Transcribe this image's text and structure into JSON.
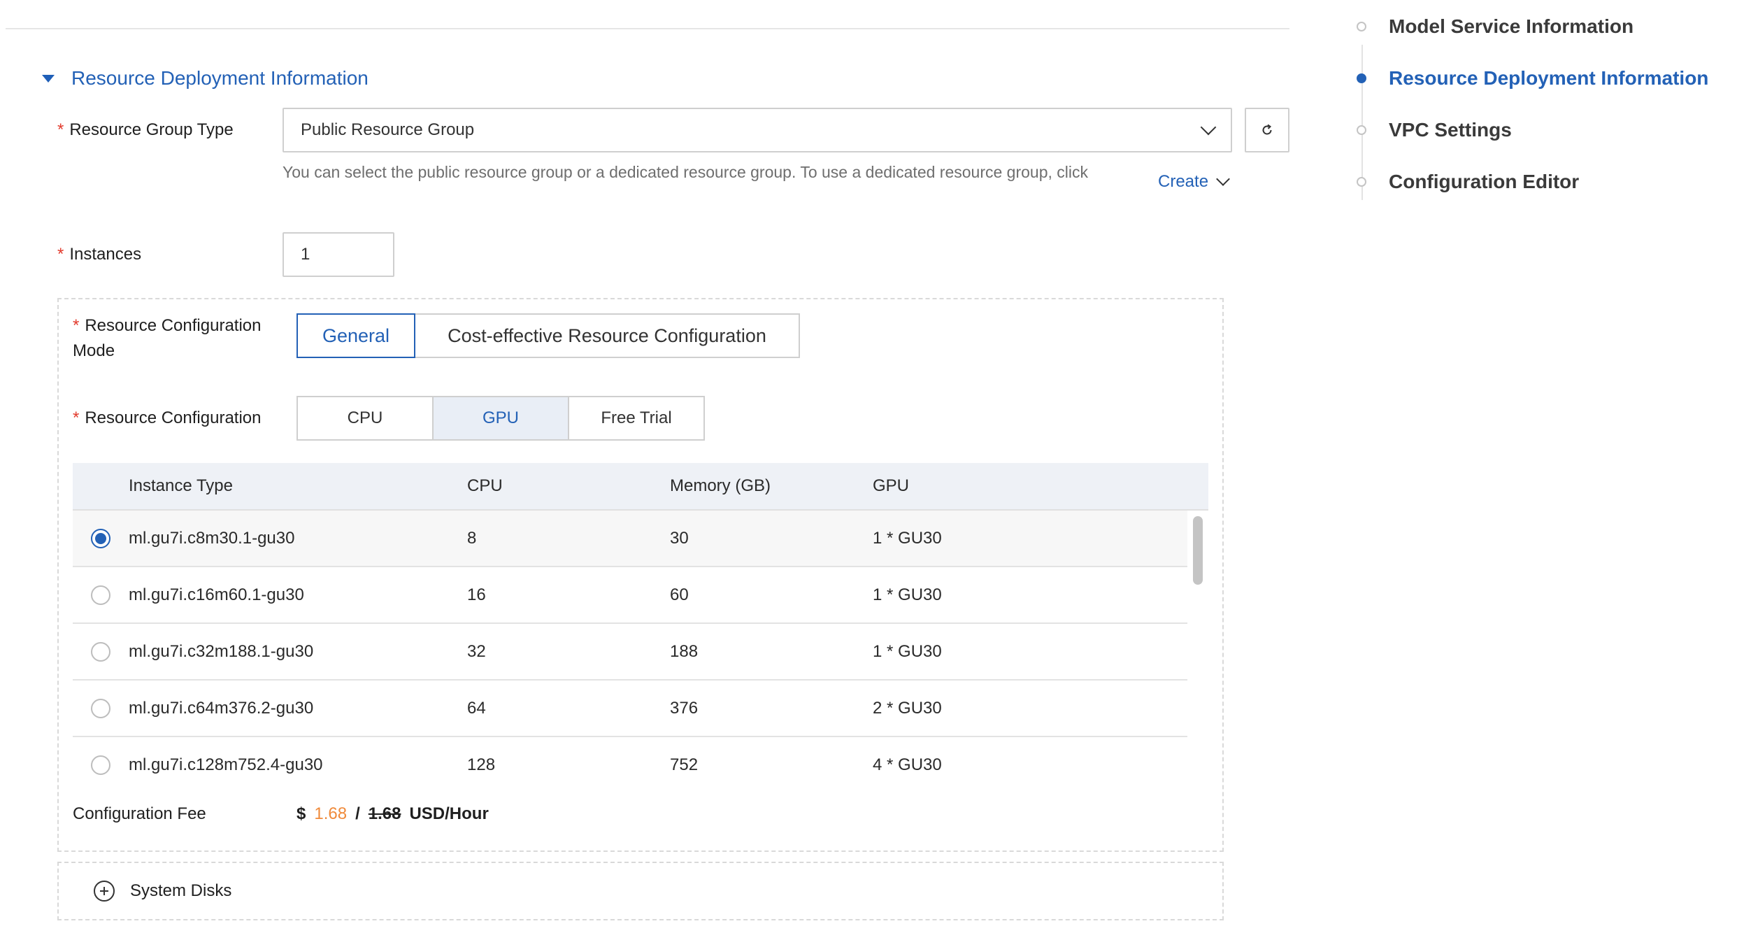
{
  "section": {
    "title": "Resource Deployment Information"
  },
  "resource_group": {
    "label": "Resource Group Type",
    "value": "Public Resource Group",
    "help_text": "You can select the public resource group or a dedicated resource group. To use a dedicated resource group, click",
    "create_link": "Create"
  },
  "instances": {
    "label": "Instances",
    "value": "1"
  },
  "config_mode": {
    "label_line1": "Resource Configuration",
    "label_line2": "Mode",
    "options": [
      "General",
      "Cost-effective Resource Configuration"
    ],
    "selected": "General"
  },
  "resource_config": {
    "label": "Resource Configuration",
    "options": [
      "CPU",
      "GPU",
      "Free Trial"
    ],
    "selected": "GPU"
  },
  "table": {
    "headers": [
      "Instance Type",
      "CPU",
      "Memory (GB)",
      "GPU"
    ],
    "rows": [
      {
        "type": "ml.gu7i.c8m30.1-gu30",
        "cpu": "8",
        "memory": "30",
        "gpu": "1 * GU30",
        "selected": true
      },
      {
        "type": "ml.gu7i.c16m60.1-gu30",
        "cpu": "16",
        "memory": "60",
        "gpu": "1 * GU30",
        "selected": false
      },
      {
        "type": "ml.gu7i.c32m188.1-gu30",
        "cpu": "32",
        "memory": "188",
        "gpu": "1 * GU30",
        "selected": false
      },
      {
        "type": "ml.gu7i.c64m376.2-gu30",
        "cpu": "64",
        "memory": "376",
        "gpu": "2 * GU30",
        "selected": false
      },
      {
        "type": "ml.gu7i.c128m752.4-gu30",
        "cpu": "128",
        "memory": "752",
        "gpu": "4 * GU30",
        "selected": false
      }
    ]
  },
  "fee": {
    "label": "Configuration Fee",
    "currency": "$",
    "price": "1.68",
    "separator": "/",
    "original_price": "1.68",
    "unit": "USD/Hour"
  },
  "system_disks": {
    "label": "System Disks"
  },
  "anchor_nav": {
    "items": [
      {
        "label": "Model Service Information",
        "active": false
      },
      {
        "label": "Resource Deployment Information",
        "active": true
      },
      {
        "label": "VPC Settings",
        "active": false
      },
      {
        "label": "Configuration Editor",
        "active": false
      }
    ]
  },
  "colors": {
    "primary": "#2361b6",
    "required": "#e23b2d",
    "price": "#f08a3a"
  }
}
